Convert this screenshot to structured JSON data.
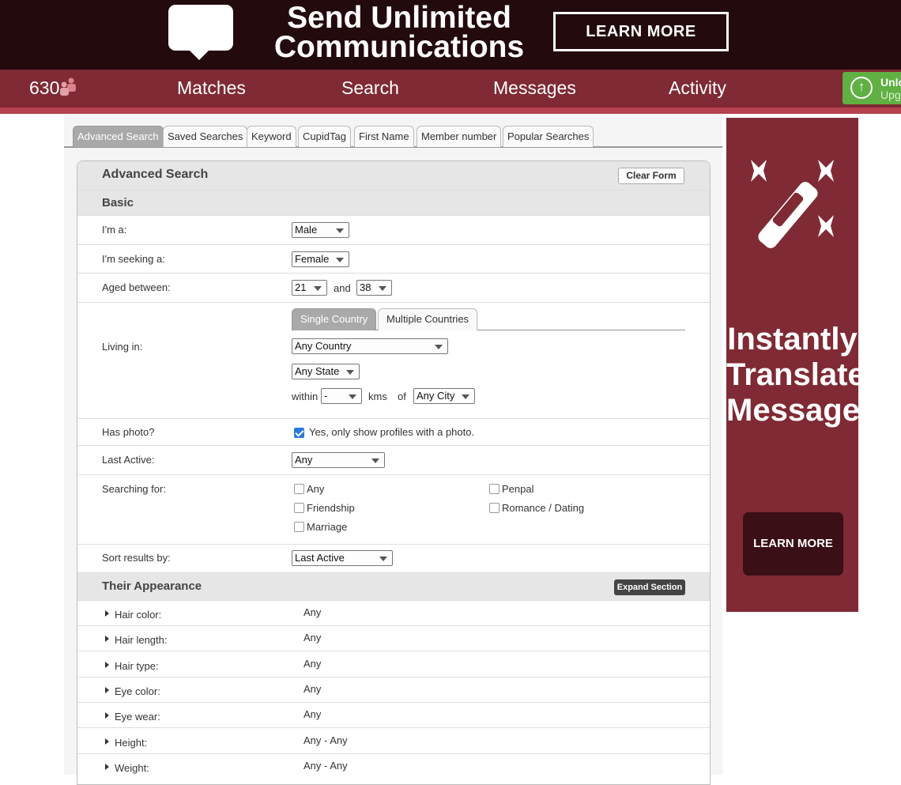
{
  "top_ad": {
    "headline_line1": "Send Unlimited",
    "headline_line2": "Communications",
    "cta": "LEARN MORE"
  },
  "nav": {
    "count": "630",
    "count_icon": "people-icon",
    "items": [
      "Matches",
      "Search",
      "Messages",
      "Activity"
    ],
    "upgrade_line1": "Unlo",
    "upgrade_line2": "Upgr",
    "upgrade_icon": "arrow-up-circle-icon"
  },
  "tabs": [
    "Advanced Search",
    "Saved Searches",
    "Keyword",
    "CupidTag",
    "First Name",
    "Member number",
    "Popular Searches"
  ],
  "active_tab": "Advanced Search",
  "form": {
    "title": "Advanced Search",
    "clear_label": "Clear Form",
    "basic_title": "Basic",
    "gender_label": "I'm a:",
    "gender_value": "Male",
    "seeking_label": "I'm seeking a:",
    "seeking_value": "Female",
    "age_label": "Aged between:",
    "age_min": "21",
    "age_and": "and",
    "age_max": "38",
    "living_label": "Living in:",
    "living_tabs": [
      "Single Country",
      "Multiple Countries"
    ],
    "country_value": "Any Country",
    "state_value": "Any State",
    "within_label": "within",
    "within_value": "-",
    "kms_label": "kms",
    "of_label": "of",
    "city_value": "Any City",
    "photo_label": "Has photo?",
    "photo_text": "Yes, only show profiles with a photo.",
    "photo_checked": true,
    "active_label": "Last Active:",
    "active_value": "Any",
    "searching_label": "Searching for:",
    "searching_options": [
      "Any",
      "Friendship",
      "Marriage",
      "Penpal",
      "Romance / Dating"
    ],
    "sort_label": "Sort results by:",
    "sort_value": "Last Active"
  },
  "appearance": {
    "title": "Their Appearance",
    "expand_label": "Expand Section",
    "rows": [
      {
        "label": "Hair color:",
        "value": "Any"
      },
      {
        "label": "Hair length:",
        "value": "Any"
      },
      {
        "label": "Hair type:",
        "value": "Any"
      },
      {
        "label": "Eye color:",
        "value": "Any"
      },
      {
        "label": "Eye wear:",
        "value": "Any"
      },
      {
        "label": "Height:",
        "value": "Any - Any"
      },
      {
        "label": "Weight:",
        "value": "Any - Any"
      }
    ]
  },
  "side_ad": {
    "headline_line1": "Instantly",
    "headline_line2": "Translate",
    "headline_line3": "Messages",
    "cta": "LEARN MORE",
    "icon": "magic-wand-icon"
  },
  "colors": {
    "nav": "#7f2a34",
    "nav_strip": "#b5424e",
    "top_ad": "#230a0d",
    "upgrade": "#60b043",
    "checkbox": "#2b78d6"
  }
}
